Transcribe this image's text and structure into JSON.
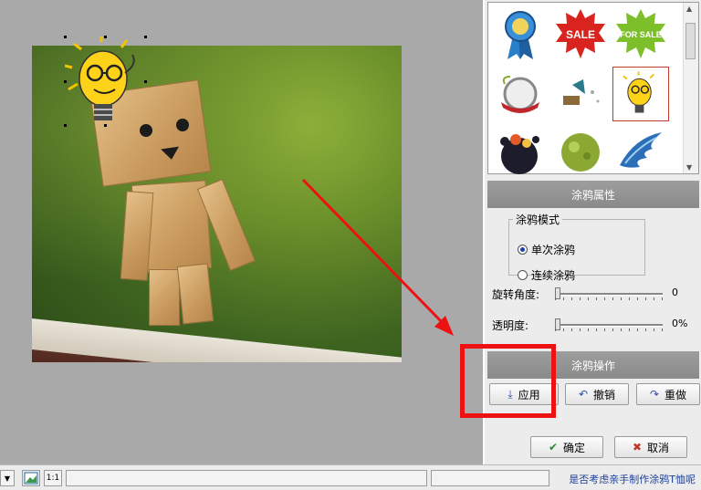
{
  "gallery": {
    "stickers": [
      {
        "name": "award-ribbon-icon",
        "text": ""
      },
      {
        "name": "sale-burst-icon",
        "text": "SALE"
      },
      {
        "name": "for-sale-burst-icon",
        "text": "FOR SALE"
      },
      {
        "name": "frame-ornament-icon",
        "text": ""
      },
      {
        "name": "gramophone-icon",
        "text": ""
      },
      {
        "name": "lightbulb-glasses-icon",
        "text": ""
      },
      {
        "name": "ink-splash-icon",
        "text": ""
      },
      {
        "name": "green-splash-icon",
        "text": ""
      },
      {
        "name": "blue-wing-icon",
        "text": ""
      }
    ],
    "selected_index": 5
  },
  "properties": {
    "header": "涂鸦属性",
    "mode_legend": "涂鸦模式",
    "mode_options": [
      "单次涂鸦",
      "连续涂鸦"
    ],
    "mode_selected": 0,
    "rotation_label": "旋转角度:",
    "rotation_value": "0",
    "opacity_label": "透明度:",
    "opacity_value": "0%"
  },
  "operations": {
    "header": "涂鸦操作",
    "apply": "应用",
    "undo": "撤销",
    "redo": "重做",
    "ok": "确定",
    "cancel": "取消"
  },
  "statusbar": {
    "zoom_label": "1:1",
    "hint": "是否考虑亲手制作涂鸦T恤呢"
  },
  "colors": {
    "highlight": "#e11111",
    "panel_header": "#8f8f8f",
    "hint_text": "#1c3f9a"
  }
}
